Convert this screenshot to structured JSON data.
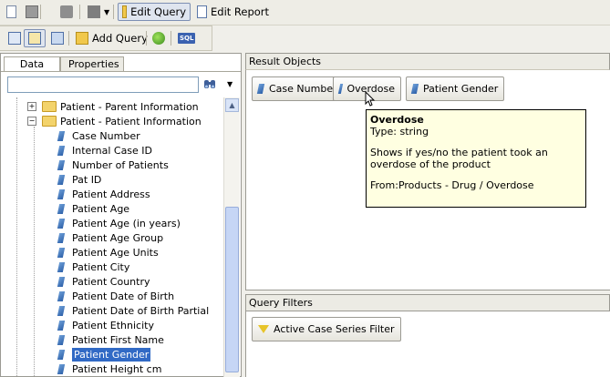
{
  "toolbar1": {
    "edit_query": "Edit Query",
    "edit_report": "Edit Report"
  },
  "toolbar2": {
    "add_query": "Add Query",
    "sql_icon_text": "SQL"
  },
  "left_panel": {
    "tabs": [
      "Data",
      "Properties"
    ],
    "search_value": "",
    "tree": {
      "folders": [
        "Patient - Parent Information",
        "Patient - Patient Information"
      ],
      "items": [
        "Case Number",
        "Internal Case ID",
        "Number of Patients",
        "Pat ID",
        "Patient Address",
        "Patient Age",
        "Patient Age (in years)",
        "Patient Age Group",
        "Patient Age Units",
        "Patient City",
        "Patient Country",
        "Patient Date of Birth",
        "Patient Date of Birth Partial",
        "Patient Ethnicity",
        "Patient First Name",
        "Patient Gender",
        "Patient Height cm"
      ],
      "selected": "Patient Gender"
    }
  },
  "result_objects": {
    "header": "Result Objects",
    "chips": [
      "Case Number",
      "Overdose",
      "Patient Gender"
    ]
  },
  "tooltip": {
    "title": "Overdose",
    "type": "Type: string",
    "desc": "Shows if yes/no the patient took an overdose of the product",
    "from": "From:Products - Drug / Overdose"
  },
  "query_filters": {
    "header": "Query Filters",
    "filter": "Active Case Series Filter"
  },
  "colors": {
    "selection": "#316ac5",
    "tooltip_bg": "#ffffe1",
    "field_icon": "#2b5fa8"
  }
}
